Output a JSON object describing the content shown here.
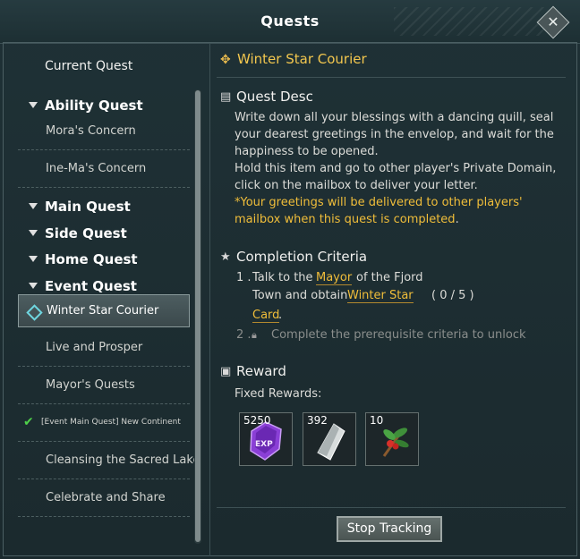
{
  "window": {
    "title": "Quests"
  },
  "left_list": {
    "current": "Current Quest",
    "ability_quest": "Ability Quest",
    "moras_concern": "Mora's Concern",
    "inemas_concern": "Ine-Ma's Concern",
    "main_quest": "Main Quest",
    "side_quest": "Side Quest",
    "home_quest": "Home Quest",
    "event_quest": "Event Quest",
    "winter_star_courier": "Winter Star Courier",
    "live_and_prosper": "Live and Prosper",
    "mayors_quests": "Mayor's Quests",
    "new_continent": "[Event Main Quest] New Continent",
    "cleansing": "Cleansing the Sacred Lake",
    "celebrate": "Celebrate and Share"
  },
  "quest": {
    "title": "Winter Star Courier",
    "desc_title": "Quest Desc",
    "desc_line1": "Write down all your blessings with a dancing quill, seal your dearest greetings in the envelop, and wait for the happiness to be opened.",
    "desc_line2": "Hold this item and go to other player's Private Domain, click on the mailbox to deliver your letter.",
    "desc_highlight": "*Your greetings will be delivered to other players' mailbox when this quest is completed",
    "desc_period": ".",
    "criteria_title": "Completion Criteria",
    "c1_num": "1 .",
    "c1_a": "Talk to the",
    "c1_mayor": "Mayor",
    "c1_b": "of the Fjord",
    "c1_c": "Town and obtain",
    "c1_item1": "Winter Star",
    "c1_progress": "( 0 / 5 )",
    "c1_item2": "Card",
    "c1_period": ".",
    "c2_num": "2 .",
    "c2_text": "Complete the prerequisite criteria to unlock",
    "reward_title": "Reward",
    "fixed_rewards": "Fixed Rewards:",
    "rewards": [
      {
        "count": "5250",
        "icon": "exp-crystal-icon"
      },
      {
        "count": "392",
        "icon": "silver-shard-icon"
      },
      {
        "count": "10",
        "icon": "holly-sprig-icon"
      }
    ],
    "stop_tracking": "Stop Tracking"
  }
}
